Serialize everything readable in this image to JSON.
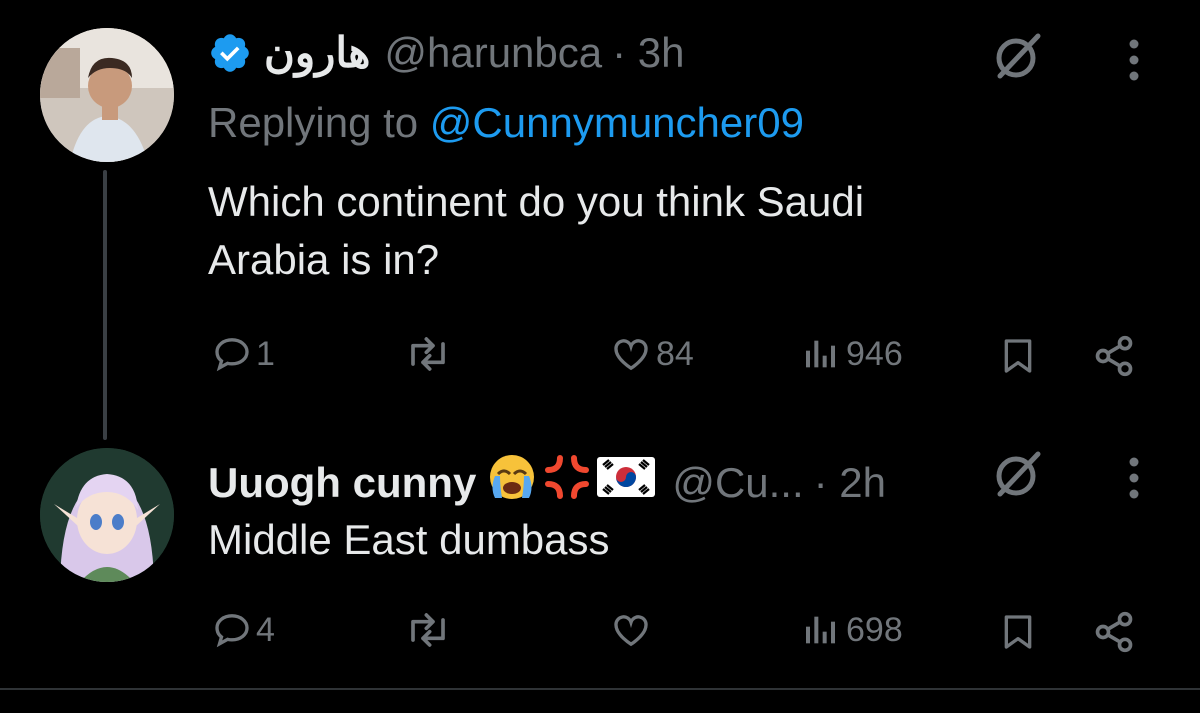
{
  "tweet1": {
    "display_name": "هارون",
    "handle": "@harunbca",
    "time": "· 3h",
    "replying_prefix": "Replying to ",
    "replying_to": "@Cunnymuncher09",
    "text_line1": "Which continent do you think Saudi",
    "text_line2": "Arabia is in?",
    "replies": "1",
    "likes": "84",
    "views": "946"
  },
  "tweet2": {
    "display_name": "Uuogh cunny",
    "handle": "@Cu...",
    "time": "· 2h",
    "text": "Middle East dumbass",
    "replies": "4",
    "views": "698"
  },
  "colors": {
    "background": "#000000",
    "text": "#e7e9ea",
    "muted": "#71767b",
    "link": "#1d9bf0",
    "verified": "#1d9bf0"
  }
}
